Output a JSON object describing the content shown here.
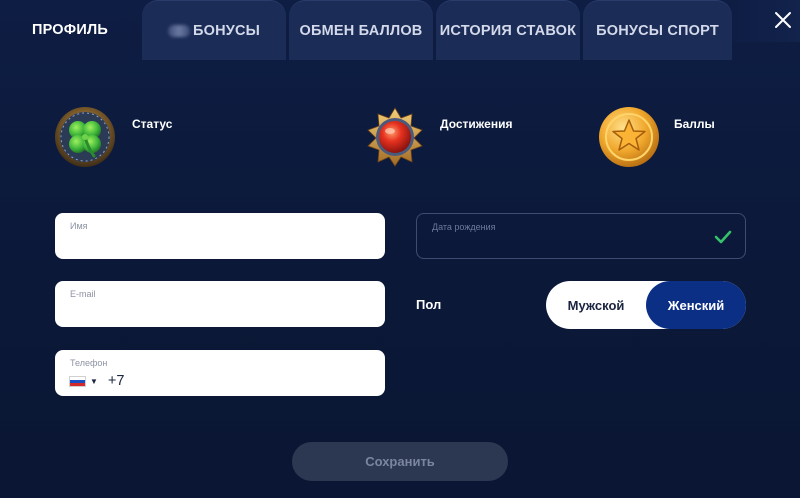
{
  "tabs": [
    {
      "label": "Профиль",
      "active": true
    },
    {
      "label": "Бонусы",
      "active": false
    },
    {
      "label": "Обмен баллов",
      "active": false
    },
    {
      "label": "История ставок",
      "active": false
    },
    {
      "label": "Бонусы спорт",
      "active": false
    }
  ],
  "badges": {
    "status": {
      "label": "Статус",
      "icon": "clover-icon"
    },
    "achievements": {
      "label": "Достижения",
      "icon": "red-gem-medal-icon"
    },
    "points": {
      "label": "Баллы",
      "icon": "gold-star-coin-icon"
    }
  },
  "form": {
    "name": {
      "label": "Имя",
      "value": ""
    },
    "email": {
      "label": "E-mail",
      "value": ""
    },
    "phone": {
      "label": "Телефон",
      "country": "russia-flag-icon",
      "prefix": "+7"
    },
    "birthdate": {
      "label": "Дата рождения",
      "value": "",
      "valid": true
    },
    "gender": {
      "label": "Пол",
      "options": [
        "Мужской",
        "Женский"
      ],
      "selected": "Женский"
    },
    "save_label": "Сохранить"
  },
  "colors": {
    "background": "#0b1838",
    "tab_inactive": "#1b2c57",
    "accent": "#0c2f86",
    "check": "#35c26b",
    "save_disabled": "#2c3752"
  }
}
